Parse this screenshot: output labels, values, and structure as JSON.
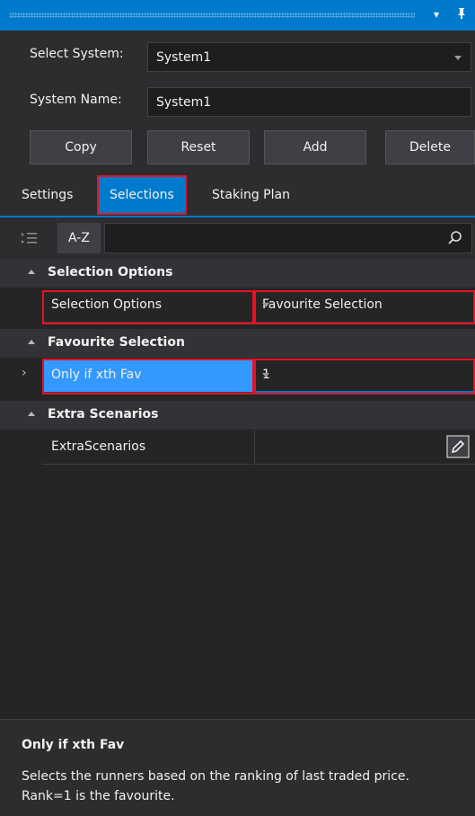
{
  "window": {
    "dropdown_icon": "chevron-down-icon",
    "pin_icon": "pin-icon"
  },
  "system_form": {
    "select_label": "Select System:",
    "select_value": "System1",
    "name_label": "System Name:",
    "name_value": "System1"
  },
  "buttons": {
    "copy": "Copy",
    "reset": "Reset",
    "add": "Add",
    "delete": "Delete"
  },
  "tabs": [
    {
      "label": "Settings"
    },
    {
      "label": "Selections"
    },
    {
      "label": "Staking Plan"
    }
  ],
  "toolbar": {
    "az_label": "A-Z",
    "search_value": ""
  },
  "grid": {
    "categories": [
      {
        "name": "Selection Options"
      },
      {
        "name": "Favourite Selection"
      },
      {
        "name": "Extra Scenarios"
      }
    ],
    "properties": [
      {
        "name": "Selection Options",
        "value": "Favourite Selection"
      },
      {
        "name": "Only if xth Fav",
        "value": "1"
      },
      {
        "name": "ExtraScenarios",
        "value": ""
      }
    ]
  },
  "description": {
    "title": "Only if xth Fav",
    "text": "Selects the runners based on the ranking of last traded price. Rank=1 is the favourite."
  },
  "colors": {
    "accent": "#007acc",
    "highlight_red": "#e81123",
    "background": "#2d2d30"
  }
}
